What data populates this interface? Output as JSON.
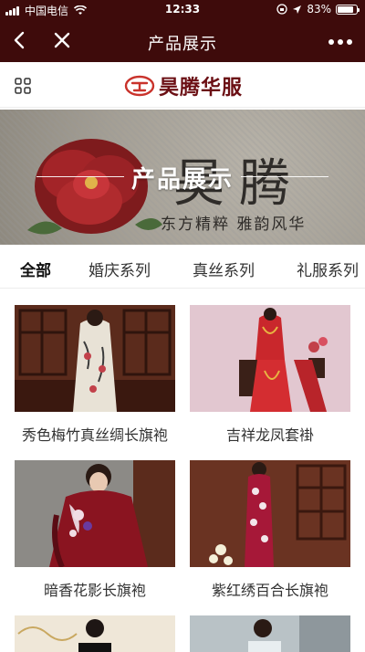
{
  "status": {
    "carrier": "中国电信",
    "time": "12:33",
    "battery": "83%",
    "battery_level": 0.83
  },
  "nav": {
    "title": "产品展示"
  },
  "brand": {
    "name": "昊腾华服"
  },
  "banner": {
    "title": "产品展示",
    "brand_big": "昊腾",
    "motto": "东方精粹 雅韵风华"
  },
  "tabs": [
    {
      "label": "全部",
      "active": true
    },
    {
      "label": "婚庆系列",
      "active": false
    },
    {
      "label": "真丝系列",
      "active": false
    },
    {
      "label": "礼服系列",
      "active": false
    }
  ],
  "products": [
    {
      "name": "秀色梅竹真丝绸长旗袍"
    },
    {
      "name": "吉祥龙凤套褂"
    },
    {
      "name": "暗香花影长旗袍"
    },
    {
      "name": "紫红绣百合长旗袍"
    }
  ],
  "colors": {
    "primary": "#3e0b0b",
    "brand_red": "#6b0f14"
  }
}
